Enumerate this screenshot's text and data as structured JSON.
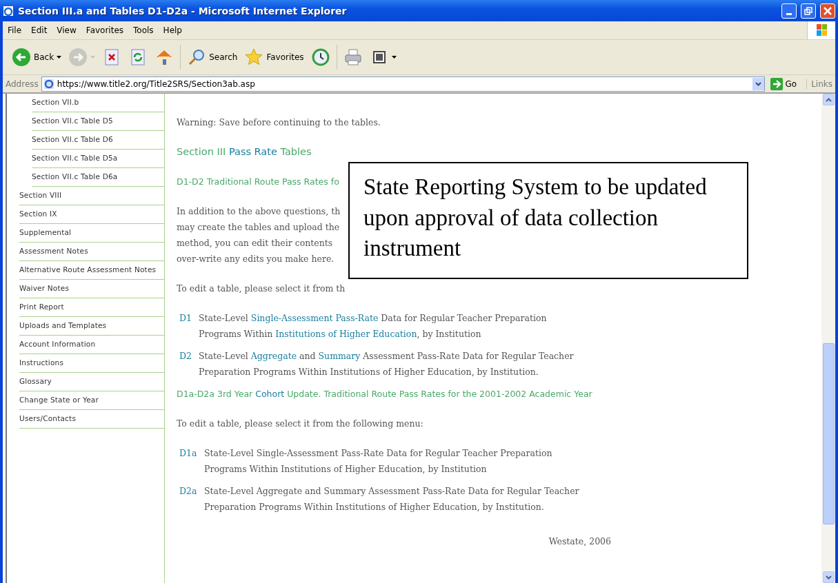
{
  "window": {
    "title": "Section III.a and Tables D1-D2a - Microsoft Internet Explorer"
  },
  "menu": [
    "File",
    "Edit",
    "View",
    "Favorites",
    "Tools",
    "Help"
  ],
  "toolbar": [
    {
      "kind": "back",
      "label": "Back",
      "dropdown": true,
      "disabled": false
    },
    {
      "kind": "forward",
      "dropdown": true,
      "disabled": true
    },
    {
      "kind": "stop",
      "dropdown": false,
      "disabled": false
    },
    {
      "kind": "refresh",
      "dropdown": false,
      "disabled": false
    },
    {
      "kind": "home",
      "dropdown": false,
      "disabled": false
    },
    {
      "kind": "search",
      "label": "Search",
      "dropdown": false,
      "disabled": false
    },
    {
      "kind": "favorites",
      "label": "Favorites",
      "dropdown": false,
      "disabled": false
    },
    {
      "kind": "history",
      "dropdown": false,
      "disabled": false
    },
    {
      "kind": "print",
      "dropdown": false,
      "disabled": false
    },
    {
      "kind": "edit",
      "dropdown": true,
      "disabled": false
    }
  ],
  "address": {
    "label": "Address",
    "value": "https://www.title2.org/Title2SRS/Section3ab.asp",
    "go": "Go",
    "links": "Links"
  },
  "sidebar": {
    "items": [
      {
        "label": "Section VII.b",
        "kind": "subsection"
      },
      {
        "label": "Section VII.c Table D5",
        "kind": "subsection"
      },
      {
        "label": "Section VII.c Table D6",
        "kind": "subsection"
      },
      {
        "label": "Section VII.c Table D5a",
        "kind": "subsection"
      },
      {
        "label": "Section VII.c Table D6a",
        "kind": "subsection"
      },
      {
        "label": "Section VIII",
        "kind": "section"
      },
      {
        "label": "Section IX",
        "kind": "section"
      },
      {
        "label": "Supplemental",
        "kind": "section"
      },
      {
        "label": "Assessment Notes",
        "kind": "section"
      },
      {
        "label": "Alternative Route Assessment Notes",
        "kind": "section"
      },
      {
        "label": "Waiver Notes",
        "kind": "section"
      },
      {
        "label": "Print Report",
        "kind": "section"
      },
      {
        "label": "Uploads and Templates",
        "kind": "section"
      },
      {
        "label": "Account Information",
        "kind": "section"
      },
      {
        "label": "Instructions",
        "kind": "section"
      },
      {
        "label": "Glossary",
        "kind": "section"
      },
      {
        "label": "Change State or Year",
        "kind": "section"
      },
      {
        "label": "Users/Contacts",
        "kind": "section"
      }
    ]
  },
  "content": [
    {
      "kind": "note",
      "text": "Warning: Save before continuing to the tables."
    },
    {
      "kind": "title",
      "parts": [
        {
          "text": "Section III ",
          "kind": "text"
        },
        {
          "text": "Pass Rate",
          "kind": "link"
        },
        {
          "text": " Tables",
          "kind": "text"
        }
      ]
    },
    {
      "kind": "subheading",
      "parts": [
        {
          "text": "D1-D2 Traditional Route Pass Rates fo",
          "kind": "text"
        }
      ]
    },
    {
      "kind": "lines",
      "lines": [
        "In addition to the above questions, th",
        "may create the tables and upload the",
        "method, you can edit their contents",
        "over-write any edits you make here."
      ]
    },
    {
      "kind": "note",
      "text": "To edit a table, please select it from th"
    },
    {
      "kind": "table_link",
      "code": "D1",
      "parts": [
        {
          "text": "State-Level ",
          "kind": "text"
        },
        {
          "text": "Single-Assessment Pass-Rate",
          "kind": "link"
        },
        {
          "text": " Data for Regular Teacher Preparation Programs Within ",
          "kind": "text"
        },
        {
          "text": "Institutions of Higher Education",
          "kind": "link"
        },
        {
          "text": ", by Institution",
          "kind": "text"
        }
      ]
    },
    {
      "kind": "table_link",
      "code": "D2",
      "parts": [
        {
          "text": "State-Level ",
          "kind": "text"
        },
        {
          "text": "Aggregate",
          "kind": "link"
        },
        {
          "text": " and ",
          "kind": "text"
        },
        {
          "text": "Summary",
          "kind": "link"
        },
        {
          "text": " Assessment Pass-Rate Data for Regular Teacher Preparation Programs Within Institutions of Higher Education, by Institution.",
          "kind": "text"
        }
      ]
    },
    {
      "kind": "subheading",
      "parts": [
        {
          "text": "D1a-D2a 3rd Year ",
          "kind": "text"
        },
        {
          "text": "Cohort",
          "kind": "link"
        },
        {
          "text": " Update. Traditional Route Pass Rates for the 2001-2002 Academic Year",
          "kind": "text"
        }
      ]
    },
    {
      "kind": "note",
      "text": "To edit a table, please select it from the following menu:"
    },
    {
      "kind": "table_link",
      "code": "D1a",
      "parts": [
        {
          "text": "State-Level Single-Assessment Pass-Rate Data for Regular Teacher Preparation Programs Within Institutions of Higher Education, by Institution",
          "kind": "text"
        }
      ]
    },
    {
      "kind": "table_link",
      "code": "D2a",
      "parts": [
        {
          "text": "State-Level Aggregate and Summary Assessment Pass-Rate Data for Regular Teacher Preparation Programs Within Institutions of Higher Education, by Institution.",
          "kind": "text"
        }
      ]
    },
    {
      "kind": "credit",
      "text": "Westate, 2006"
    }
  ],
  "overlay": {
    "text": "State Reporting System to be updated upon approval of data collection instrument"
  }
}
